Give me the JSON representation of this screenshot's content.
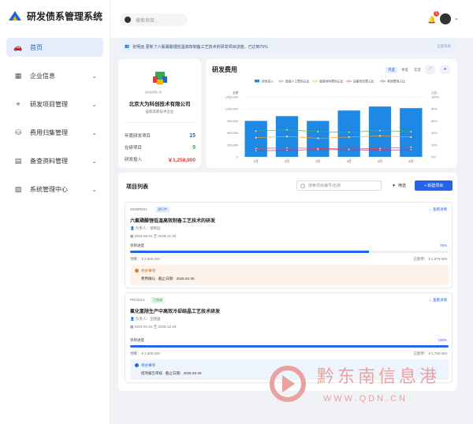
{
  "app": {
    "title": "研发债系管理系统"
  },
  "sidebar": {
    "items": [
      {
        "label": "首页",
        "icon": "car-icon",
        "active": true
      },
      {
        "label": "企业信息",
        "icon": "building-icon"
      },
      {
        "label": "研发项目管理",
        "icon": "location-icon"
      },
      {
        "label": "费用归集管理",
        "icon": "coins-icon"
      },
      {
        "label": "备查资料管理",
        "icon": "folder-icon"
      },
      {
        "label": "系统管理中心",
        "icon": "chart-icon"
      }
    ]
  },
  "topbar": {
    "search_placeholder": "搜索项目...",
    "badge": "1"
  },
  "notice": {
    "text": "张明远 更新了六氟磷酸锂低温高效制备工艺技术的研发项目进度，已达到75%",
    "more": "全部消息"
  },
  "company": {
    "logo_text": "某科技有限公司",
    "name": "北京大为科创技术有限公司",
    "type": "国家高新技术企业",
    "stats": [
      {
        "label": "年度研发项目",
        "value": "15",
        "color": "#1e66d8"
      },
      {
        "label": "在研项目",
        "value": "9",
        "color": "#3aa84a"
      },
      {
        "label": "研发投入",
        "value": "￥1,258,900",
        "color": "#e03a3a"
      }
    ]
  },
  "chart_card": {
    "title": "研发费用",
    "toggles": [
      "月度",
      "季度",
      "年度"
    ]
  },
  "chart_data": {
    "type": "bar",
    "categories": [
      "1月",
      "2月",
      "3月",
      "4月",
      "5月",
      "6月"
    ],
    "series": [
      {
        "name": "研发投入",
        "type": "bar",
        "values": [
          900000,
          1020000,
          900000,
          1160000,
          1260000,
          1220000
        ],
        "color": "#1e88e5"
      },
      {
        "name": "直接人工费用占比",
        "type": "line",
        "values": [
          43,
          45,
          42,
          41,
          44,
          42
        ],
        "color": "#4caf50"
      },
      {
        "name": "直接材料费用占比",
        "type": "line",
        "values": [
          32,
          34,
          31,
          33,
          35,
          33
        ],
        "color": "#f5a623"
      },
      {
        "name": "设备折旧费占比",
        "type": "line",
        "values": [
          14,
          15,
          14,
          13,
          14,
          16
        ],
        "color": "#e04848"
      },
      {
        "name": "其他费用占比",
        "type": "line",
        "values": [
          10,
          11,
          12,
          12,
          11,
          12
        ],
        "color": "#8e44ad"
      }
    ],
    "ylabel": "金额",
    "y2label": "占比",
    "ylim": [
      0,
      1500000
    ],
    "y2lim": [
      0,
      100
    ],
    "yticks": [
      "0",
      "300,000",
      "600,000",
      "900,000",
      "1,200,000",
      "1,500,000"
    ],
    "y2ticks": [
      "0%",
      "20%",
      "40%",
      "60%",
      "80%",
      "100%"
    ],
    "grid": true,
    "legend": "top"
  },
  "projects": {
    "title": "项目列表",
    "search_placeholder": "搜索项目编号/名称",
    "filter_label": "筛选",
    "new_label": "+ 新建项目",
    "items": [
      {
        "code": "2025RD01",
        "status": "进行中",
        "status_color": "#1e66d8",
        "status_bg": "#e6eefc",
        "name": "六氟磷酸锂低温高效制备工艺技术的研发",
        "owner": "负责人：张明远",
        "dates": "2024-06-01 至 2025-11-20",
        "progress_label": "项目进度",
        "progress": 75,
        "progress_text": "75%",
        "budget": "预算：￥2,500,000",
        "used": "已使用：￥1,875,000",
        "todo_title": "待办事项",
        "todo_text": "费用确认 · 截止日期：2025-03-30",
        "detail": "→ 查看详情"
      },
      {
        "code": "PRJ2012",
        "status": "已完成",
        "status_color": "#2e9d52",
        "status_bg": "#e4f5ea",
        "name": "氟化氢除生产中高效冷却结晶工艺技术研发",
        "owner": "负责人：王晓国",
        "dates": "2024-01-01 至 2025-12-29",
        "progress_label": "项目进度",
        "progress": 100,
        "progress_text": "100%",
        "budget": "预算：￥1,800,000",
        "used": "已使用：￥1,750,000",
        "todo_title": "待办事项",
        "todo_text": "结项报告审核 · 截止日期：2025-03-28",
        "detail": "→ 查看详情"
      }
    ]
  },
  "watermark": {
    "chars": [
      "黔",
      "东",
      "南",
      "信",
      "息",
      "港"
    ],
    "url": "WWW.QDN.CN"
  }
}
